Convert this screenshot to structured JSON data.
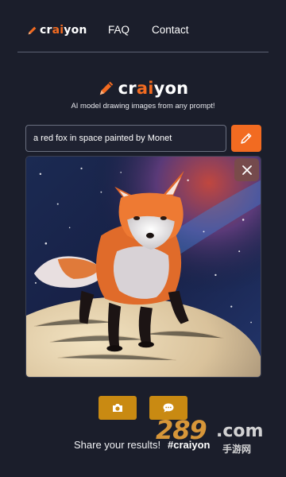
{
  "colors": {
    "background": "#1b1e2b",
    "accent": "#f26b21",
    "action_button": "#c98a12"
  },
  "nav": {
    "logo": {
      "prefix": "cr",
      "highlight": "ai",
      "suffix": "yon"
    },
    "links": [
      "FAQ",
      "Contact"
    ]
  },
  "hero": {
    "logo": {
      "prefix": "cr",
      "highlight": "ai",
      "suffix": "yon"
    },
    "tagline": "AI model drawing images from any prompt!"
  },
  "prompt": {
    "value": "a red fox in space painted by Monet",
    "draw_icon": "pencil-icon"
  },
  "result": {
    "image_icon": "generated-image",
    "close_icon": "close-icon"
  },
  "actions": [
    {
      "icon": "camera-icon"
    },
    {
      "icon": "chat-icon"
    }
  ],
  "share": {
    "text": "Share your results!",
    "hashtag": "#craiyon"
  },
  "watermark": {
    "number": "289",
    "domain": ".com",
    "chinese": "手游网"
  }
}
